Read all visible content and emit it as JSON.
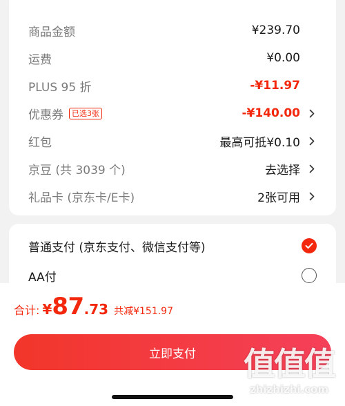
{
  "summary": {
    "rows": [
      {
        "label": "商品金额",
        "value": "¥239.70",
        "chevron": false
      },
      {
        "label": "运费",
        "value": "¥0.00",
        "chevron": false
      },
      {
        "label": "PLUS 95 折",
        "value": "-¥11.97",
        "chevron": false
      },
      {
        "label": "优惠券",
        "badge": "已选3张",
        "value": "-¥140.00",
        "chevron": true
      },
      {
        "label": "红包",
        "value": "最高可抵¥0.10",
        "chevron": true
      },
      {
        "label": "京豆 (共 3039 个)",
        "value": "去选择",
        "chevron": true
      },
      {
        "label": "礼品卡 (京东卡/E卡)",
        "value": "2张可用",
        "chevron": true
      }
    ]
  },
  "payment": {
    "options": [
      {
        "label": "普通支付 (京东支付、微信支付等)",
        "selected": true
      },
      {
        "label": "AA付",
        "selected": false
      }
    ]
  },
  "total": {
    "label": "合计:",
    "currency": "¥",
    "integer": "87",
    "decimal": ".73",
    "saved": "共减¥151.97"
  },
  "pay_button": {
    "label": "立即支付"
  },
  "watermark": {
    "chars": "值值值",
    "url": "zhizhizhi.com"
  },
  "colors": {
    "accent": "#f2270c",
    "button_gradient_start": "#f2362a",
    "button_gradient_end": "#f5405a"
  },
  "icons": [
    "chevron-right-icon",
    "checkmark-icon",
    "radio-empty-icon"
  ]
}
